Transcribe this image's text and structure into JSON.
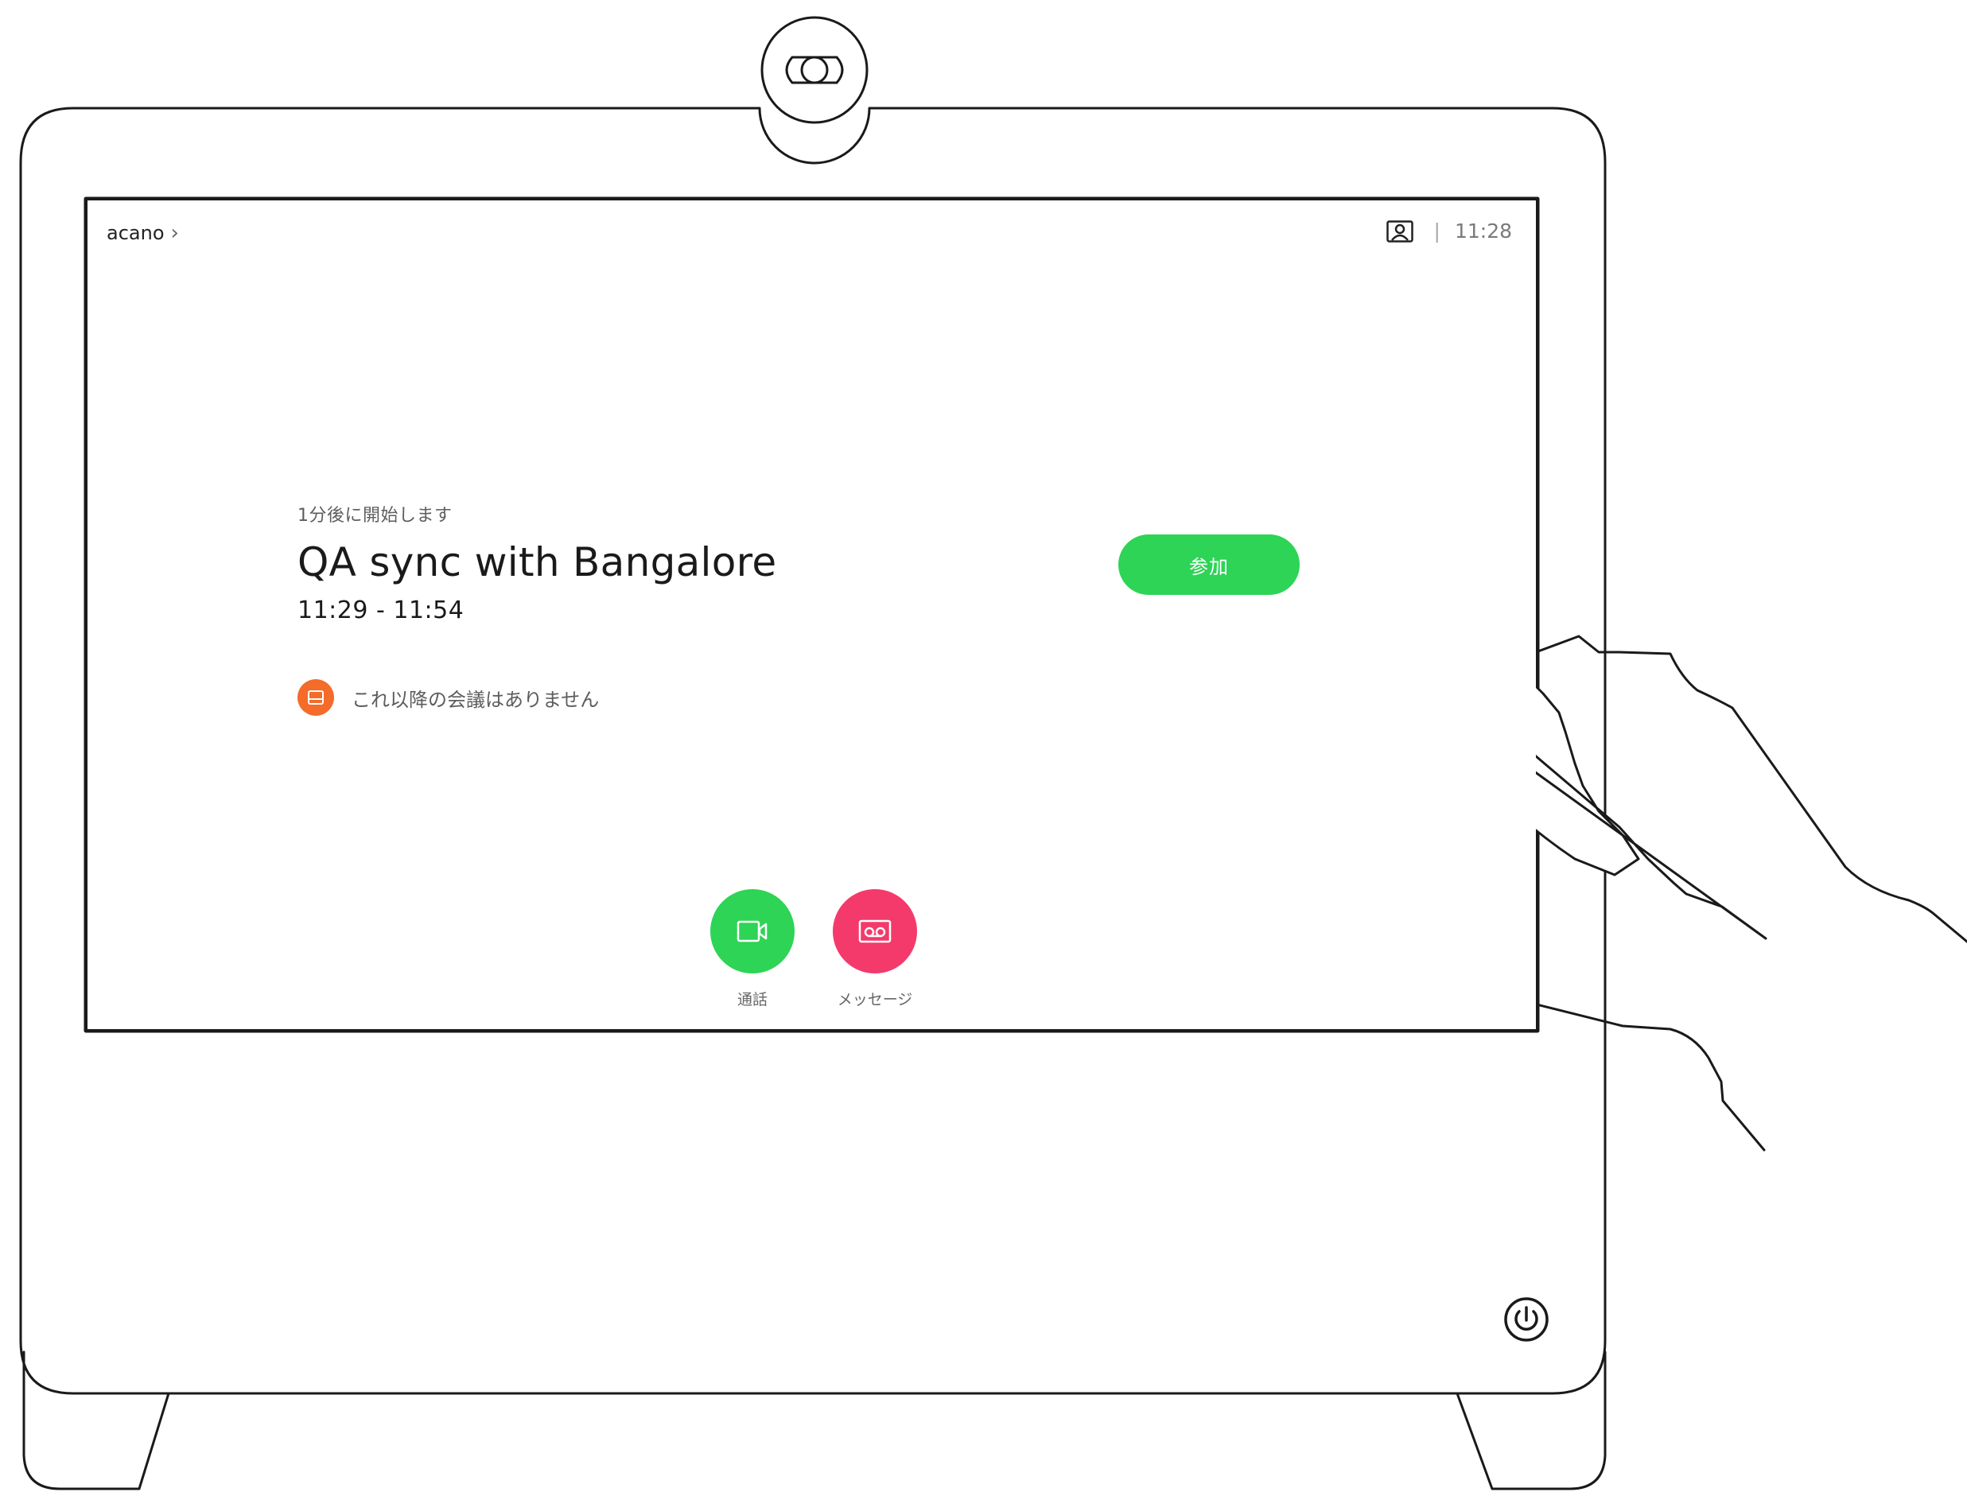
{
  "header": {
    "location": "acano",
    "clock": "11:28",
    "separator": "|",
    "self_view_icon": "self-view-icon"
  },
  "meeting": {
    "starts_in": "1分後に開始します",
    "title": "QA sync with Bangalore",
    "time_range": "11:29 - 11:54",
    "no_more_meetings": "これ以降の会議はありません",
    "join_label": "参加"
  },
  "actions": {
    "call_label": "通話",
    "message_label": "メッセージ"
  },
  "colors": {
    "accent_green": "#2dd455",
    "message_pink": "#f43a6b",
    "calendar_orange": "#f46b2a"
  }
}
